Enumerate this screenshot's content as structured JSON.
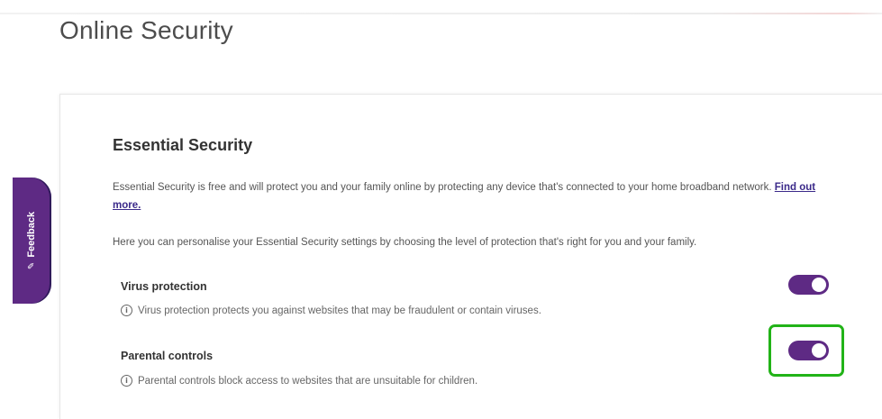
{
  "page": {
    "title": "Online Security"
  },
  "feedback_tab": {
    "label": "Feedback",
    "icon": "feedback-icon",
    "color": "#5e2a84"
  },
  "essential_security": {
    "title": "Essential Security",
    "description": "Essential Security is free and will protect you and your family online by protecting any device that's connected to your home broadband network.",
    "find_out_more": "Find out more.",
    "personalise_text": "Here you can personalise your Essential Security settings by choosing the level of protection that's right for you and your family."
  },
  "settings": [
    {
      "title": "Virus protection",
      "note": "Virus protection protects you against websites that may be fraudulent or contain viruses.",
      "enabled": true
    },
    {
      "title": "Parental controls",
      "note": "Parental controls block access to websites that are unsuitable for children.",
      "enabled": true,
      "highlighted": true
    }
  ],
  "colors": {
    "toggle_on": "#5e2a84",
    "highlight": "#22b318",
    "link": "#3b2a8a"
  }
}
